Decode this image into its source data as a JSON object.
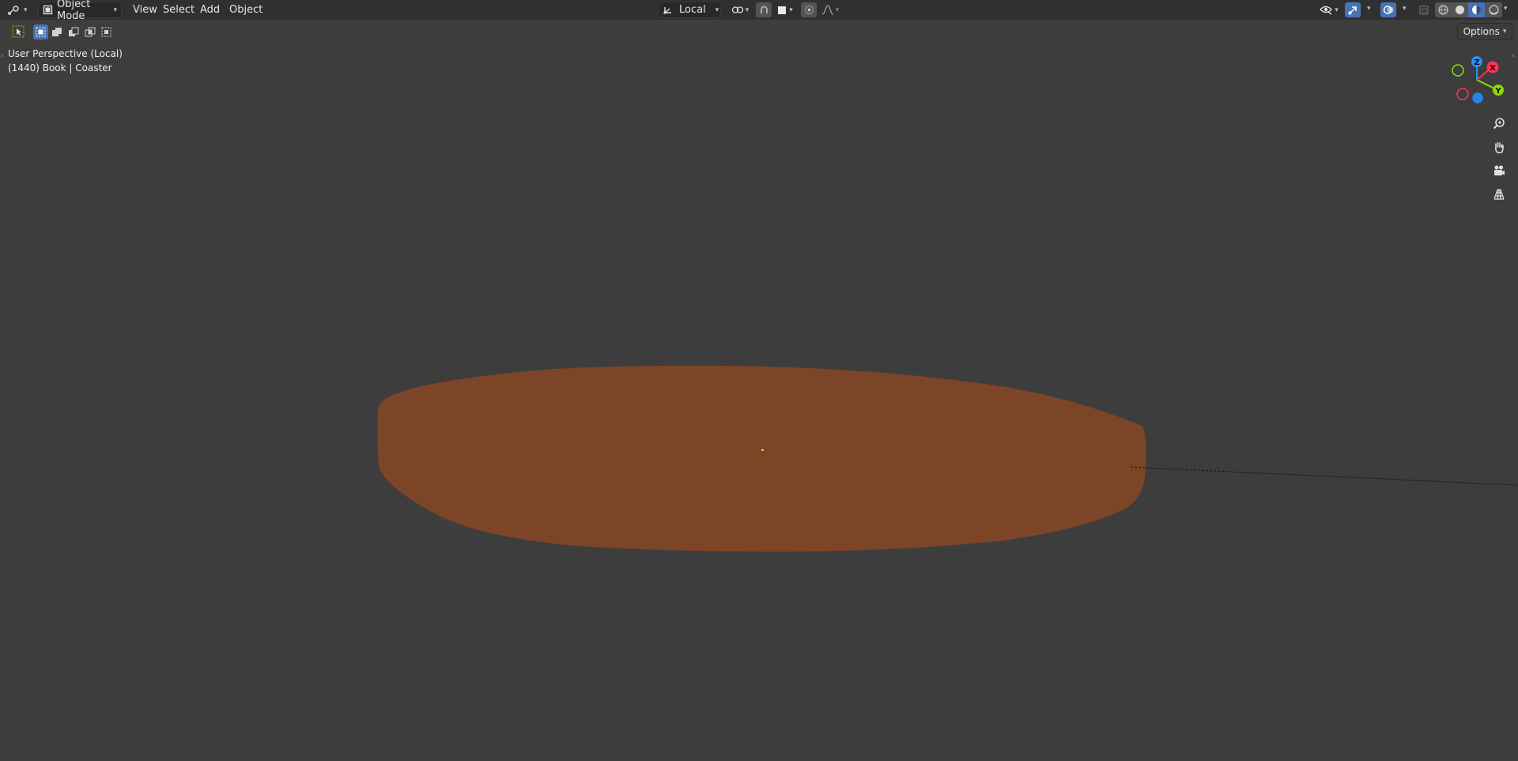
{
  "header": {
    "editor_type_icon": "view3d-editor-icon",
    "mode": {
      "icon": "object-mode-icon",
      "label": "Object Mode"
    },
    "menus": [
      "View",
      "Select",
      "Add",
      "Object"
    ],
    "transform_orientation": {
      "icon": "orientation-icon",
      "label": "Local"
    },
    "pivot_icon": "pivot-point-icon",
    "snap_icon": "snap-magnet-icon",
    "snap_target_icon": "snap-increment-icon",
    "proportional_icon": "proportional-edit-icon",
    "falloff_icon": "falloff-curve-icon",
    "visibility_icon": "eye-selectability-icon",
    "gizmo_icon": "gizmo-icon",
    "overlay_icon": "overlay-icon",
    "xray_icon": "xray-icon",
    "shading_modes": [
      "wireframe",
      "solid",
      "material-preview",
      "rendered"
    ],
    "active_shading": "material-preview"
  },
  "toolbar": {
    "active_tool_icon": "select-box-tool-icon",
    "select_modes": [
      "set-new",
      "extend",
      "subtract",
      "invert",
      "intersect"
    ],
    "active_select_mode": "set-new"
  },
  "viewport": {
    "view_name": "User Perspective (Local)",
    "object_info": "(1440) Book | Coaster",
    "options_label": "Options",
    "object_color": "#7d4527",
    "background_color": "#3d3d3d"
  },
  "navigation_gizmo": {
    "axes": {
      "x": "X",
      "y": "Y",
      "z": "Z"
    },
    "colors": {
      "x": "#ff3352",
      "y": "#8bdc00",
      "z": "#2890ff"
    },
    "buttons": [
      "zoom-icon",
      "pan-hand-icon",
      "camera-view-icon",
      "ortho-grid-icon"
    ]
  }
}
